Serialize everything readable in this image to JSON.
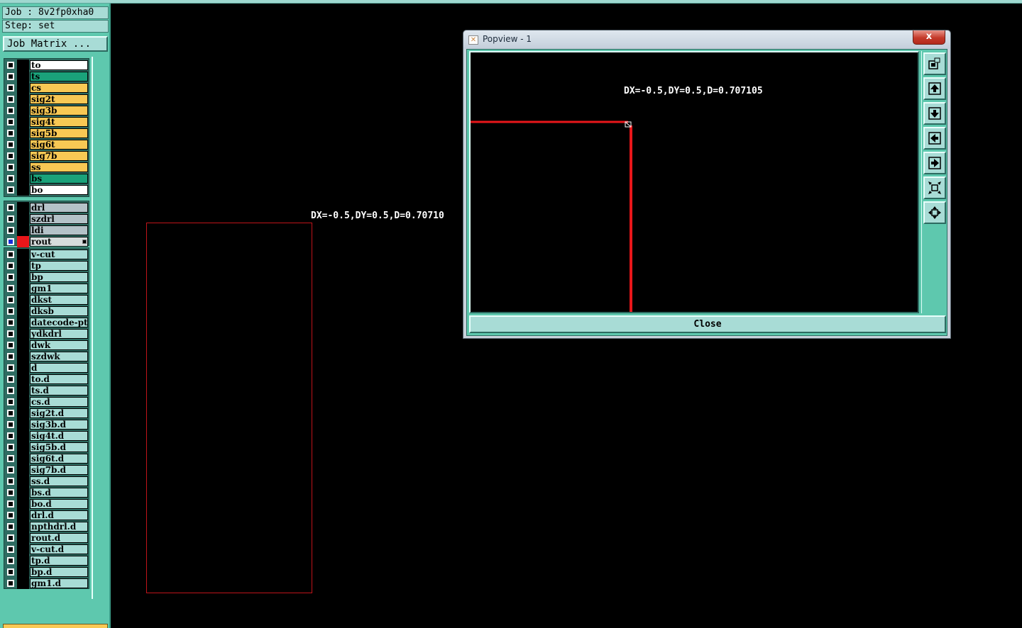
{
  "header": {
    "job_text": "Job : 8v2fp0xha0",
    "step_text": "Step: set",
    "matrix_button": "Job Matrix ..."
  },
  "layers": {
    "board": [
      {
        "name": "to",
        "color": "#ffffff"
      },
      {
        "name": "ts",
        "color": "#1aa27a"
      },
      {
        "name": "cs",
        "color": "#f8c854"
      },
      {
        "name": "sig2t",
        "color": "#f8c854"
      },
      {
        "name": "sig3b",
        "color": "#f8c854"
      },
      {
        "name": "sig4t",
        "color": "#f8c854"
      },
      {
        "name": "sig5b",
        "color": "#f8c854"
      },
      {
        "name": "sig6t",
        "color": "#f8c854"
      },
      {
        "name": "sig7b",
        "color": "#f8c854"
      },
      {
        "name": "ss",
        "color": "#f8c854"
      },
      {
        "name": "bs",
        "color": "#1aa27a"
      },
      {
        "name": "bo",
        "color": "#ffffff"
      }
    ],
    "drill": [
      {
        "name": "drl",
        "color": "#b4c2c8"
      },
      {
        "name": "szdrl",
        "color": "#b4c2c8"
      },
      {
        "name": "ldi",
        "color": "#b4c2c8"
      },
      {
        "name": "rout",
        "color": "#d6dcdc",
        "active": true
      }
    ],
    "misc": [
      {
        "name": "v-cut"
      },
      {
        "name": "tp"
      },
      {
        "name": "bp"
      },
      {
        "name": "gm1"
      },
      {
        "name": "dkst"
      },
      {
        "name": "dksb"
      },
      {
        "name": "datecode-ptc"
      },
      {
        "name": "ydkdrl"
      },
      {
        "name": "dwk"
      },
      {
        "name": "szdwk"
      },
      {
        "name": "d"
      },
      {
        "name": "to.d"
      },
      {
        "name": "ts.d"
      },
      {
        "name": "cs.d"
      },
      {
        "name": "sig2t.d"
      },
      {
        "name": "sig3b.d"
      },
      {
        "name": "sig4t.d"
      },
      {
        "name": "sig5b.d"
      },
      {
        "name": "sig6t.d"
      },
      {
        "name": "sig7b.d"
      },
      {
        "name": "ss.d"
      },
      {
        "name": "bs.d"
      },
      {
        "name": "bo.d"
      },
      {
        "name": "drl.d"
      },
      {
        "name": "npthdrl.d"
      },
      {
        "name": "rout.d"
      },
      {
        "name": "v-cut.d"
      },
      {
        "name": "tp.d"
      },
      {
        "name": "bp.d"
      },
      {
        "name": "gm1.d"
      }
    ],
    "misc_color": "#a8dcd6"
  },
  "canvas": {
    "measure_label": "DX=-0.5,DY=0.5,D=0.70710",
    "outline_color": "#c0141a"
  },
  "popview": {
    "title": "Popview - 1",
    "close_x": "x",
    "measure_label": "DX=-0.5,DY=0.5,D=0.707105",
    "close_button": "Close",
    "line_color": "#e8161a",
    "tools": [
      "zoom-home-icon",
      "pan-up-icon",
      "pan-down-icon",
      "pan-left-icon",
      "pan-right-icon",
      "zoom-out-icon",
      "zoom-in-icon"
    ]
  }
}
